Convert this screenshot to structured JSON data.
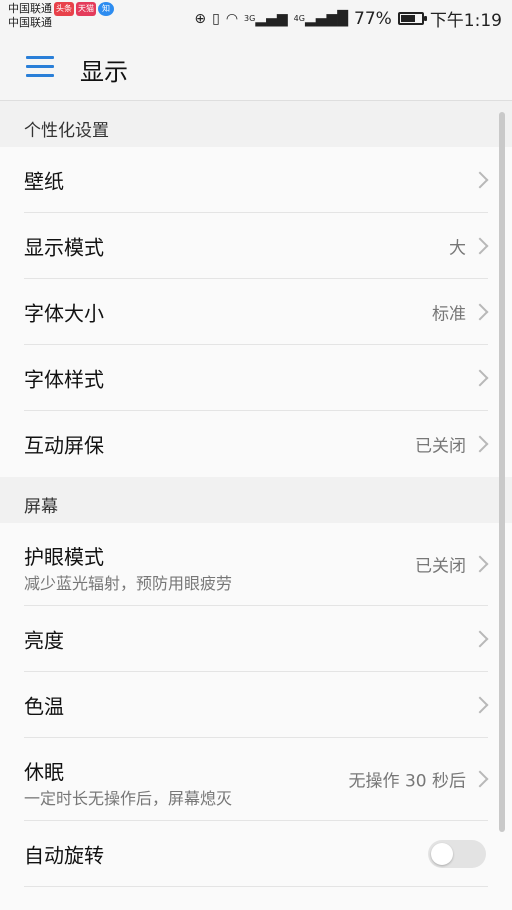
{
  "status_bar": {
    "carrier_1": "中国联通",
    "carrier_2": "中国联通",
    "notif_toutiao": "头条",
    "notif_tmall": "天猫",
    "notif_zhihu": "知",
    "signal_3g": "3G",
    "signal_4g": "4G",
    "battery_text": "77%",
    "battery_level": 0.77,
    "time": "下午1:19"
  },
  "header": {
    "title": "显示",
    "accent_color": "#2a7fd8"
  },
  "sections": [
    {
      "header": "个性化设置",
      "items": [
        {
          "title": "壁纸",
          "value": ""
        },
        {
          "title": "显示模式",
          "value": "大"
        },
        {
          "title": "字体大小",
          "value": "标准"
        },
        {
          "title": "字体样式",
          "value": ""
        },
        {
          "title": "互动屏保",
          "value": "已关闭"
        }
      ]
    },
    {
      "header": "屏幕",
      "items": [
        {
          "title": "护眼模式",
          "subtitle": "减少蓝光辐射，预防用眼疲劳",
          "value": "已关闭"
        },
        {
          "title": "亮度",
          "value": ""
        },
        {
          "title": "色温",
          "value": ""
        },
        {
          "title": "休眠",
          "subtitle": "一定时长无操作后，屏幕熄灭",
          "value": "无操作 30 秒后"
        },
        {
          "title": "自动旋转",
          "toggle": false
        }
      ]
    }
  ]
}
